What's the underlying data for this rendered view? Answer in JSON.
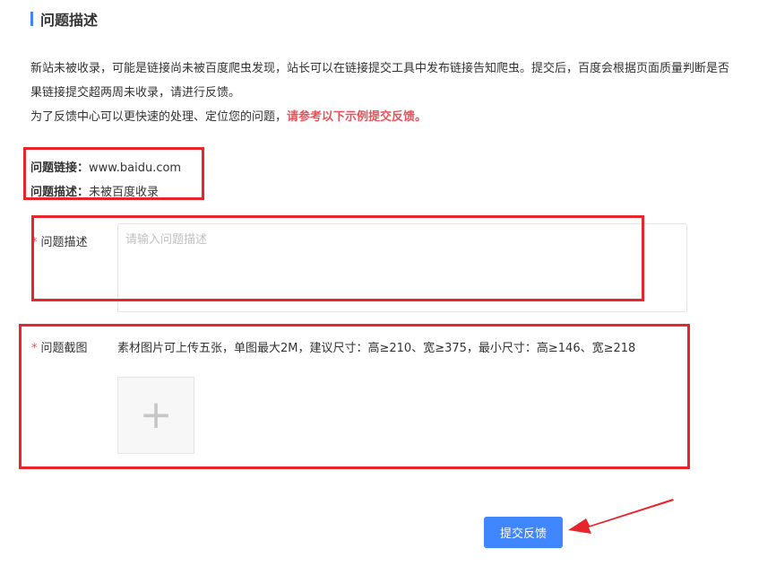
{
  "section": {
    "title": "问题描述"
  },
  "intro": {
    "line1": "新站未被收录，可能是链接尚未被百度爬虫发现，站长可以在链接提交工具中发布链接告知爬虫。提交后，百度会根据页面质量判断是否",
    "line2": "果链接提交超两周未收录，请进行反馈。",
    "line3_prefix": "为了反馈中心可以更快速的处理、定位您的问题，",
    "line3_highlight": "请参考以下示例提交反馈。"
  },
  "example": {
    "link_key": "问题链接",
    "link_sep": "：",
    "link_value": "www.baidu.com",
    "desc_key": "问题描述",
    "desc_sep": "：",
    "desc_value": "未被百度收录"
  },
  "form": {
    "required_mark": "*",
    "desc_label": "问题描述",
    "desc_placeholder": "请输入问题描述",
    "screenshot_label": "问题截图",
    "upload_hint": "素材图片可上传五张，单图最大2M，建议尺寸：高≥210、宽≥375，最小尺寸：高≥146、宽≥218",
    "upload_symbol": "+",
    "submit_label": "提交反馈"
  },
  "colors": {
    "accent": "#3f86ff",
    "highlight": "#e8535b",
    "annotation": "#e6262b"
  },
  "icons": {
    "upload": "plus-icon",
    "annotation": "arrow-icon"
  }
}
